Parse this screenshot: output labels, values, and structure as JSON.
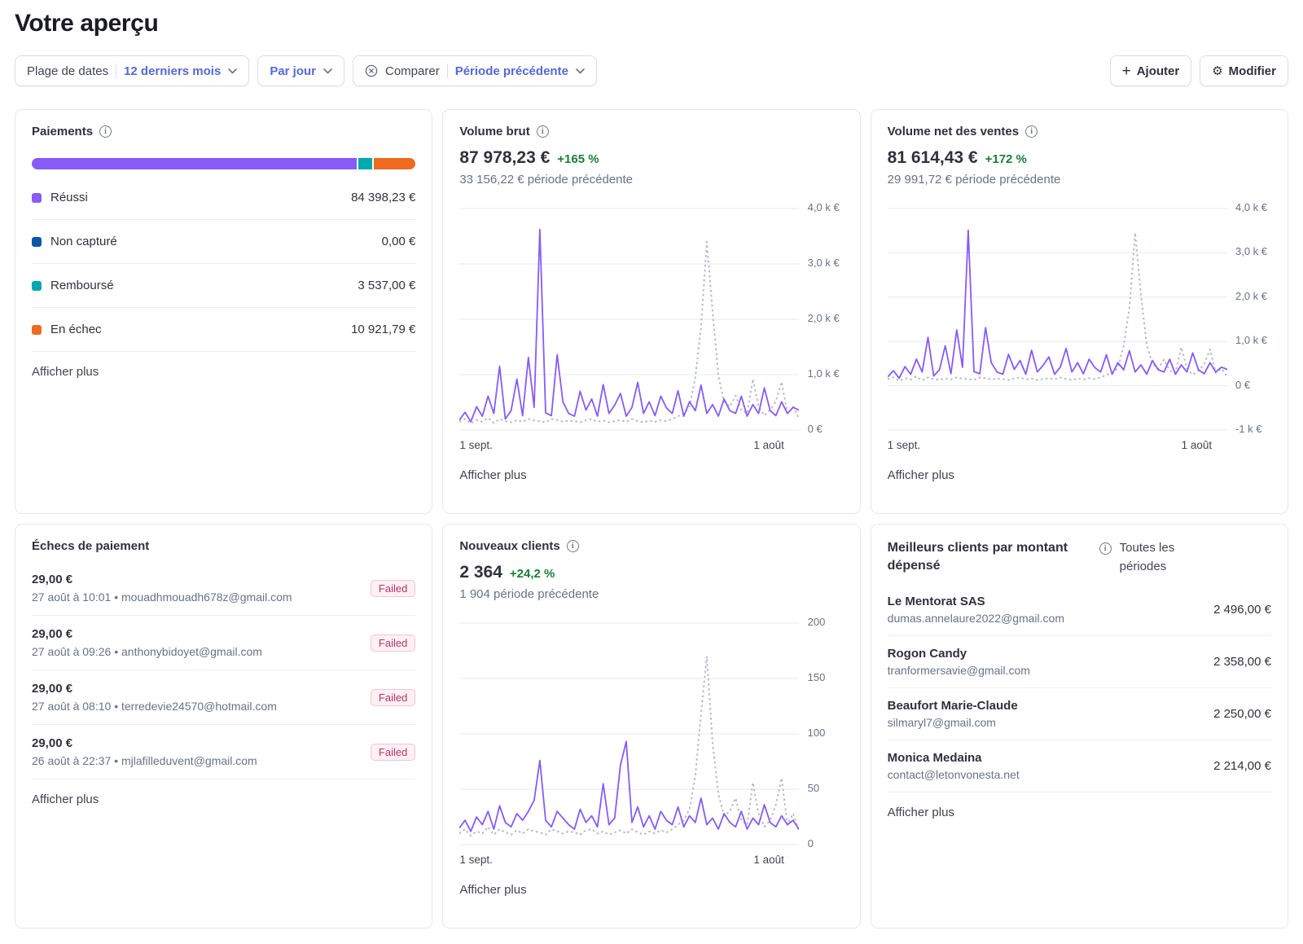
{
  "header": {
    "title": "Votre aperçu"
  },
  "icons": {
    "info": "i",
    "plus": "+",
    "gear": "⚙"
  },
  "colors": {
    "accent_purple": "#875bf7",
    "compare_gray": "#b3bbc8",
    "grid": "#e7eaf0",
    "success_green": "#1a7f37",
    "link_blue": "#5469d4",
    "navy": "#0e56a8",
    "teal": "#00a8b0",
    "orange": "#ed6a1f",
    "badge_bg": "#fff0f3",
    "badge_text": "#b3356b",
    "badge_border": "#f0c6d4"
  },
  "toolbar": {
    "filters": {
      "date_range_label": "Plage de dates",
      "date_range_value": "12 derniers mois",
      "interval_value": "Par jour",
      "compare_label": "Comparer",
      "compare_value": "Période précédente"
    },
    "actions": {
      "add": "Ajouter",
      "edit": "Modifier"
    }
  },
  "cards": {
    "payments": {
      "title": "Paiements",
      "items": [
        {
          "label": "Réussi",
          "value": "84 398,23 €",
          "color": "#875bf7",
          "fraction": 0.854
        },
        {
          "label": "Non capturé",
          "value": "0,00 €",
          "color": "#0e56a8",
          "fraction": 0
        },
        {
          "label": "Remboursé",
          "value": "3 537,00 €",
          "color": "#00a8b0",
          "fraction": 0.036
        },
        {
          "label": "En échec",
          "value": "10 921,79 €",
          "color": "#ed6a1f",
          "fraction": 0.11
        }
      ],
      "show_more": "Afficher plus"
    },
    "gross_volume": {
      "title": "Volume brut",
      "amount": "87 978,23 €",
      "delta": "+165 %",
      "previous": "33 156,22 € période précédente",
      "show_more": "Afficher plus"
    },
    "net_volume": {
      "title": "Volume net des ventes",
      "amount": "81 614,43 €",
      "delta": "+172 %",
      "previous": "29 991,72 € période précédente",
      "show_more": "Afficher plus"
    },
    "failed_payments": {
      "title": "Échecs de paiement",
      "items": [
        {
          "amount": "29,00 €",
          "meta": "27 août à 10:01 • mouadhmouadh678z@gmail.com",
          "badge": "Failed"
        },
        {
          "amount": "29,00 €",
          "meta": "27 août à 09:26 • anthonybidoyet@gmail.com",
          "badge": "Failed"
        },
        {
          "amount": "29,00 €",
          "meta": "27 août à 08:10 • terredevie24570@hotmail.com",
          "badge": "Failed"
        },
        {
          "amount": "29,00 €",
          "meta": "26 août à 22:37 • mjlafilleduvent@gmail.com",
          "badge": "Failed"
        }
      ],
      "show_more": "Afficher plus"
    },
    "new_customers": {
      "title": "Nouveaux clients",
      "amount": "2 364",
      "delta": "+24,2 %",
      "previous": "1 904 période précédente",
      "show_more": "Afficher plus"
    },
    "top_customers": {
      "title": "Meilleurs clients par montant dépensé",
      "period_label": "Toutes les périodes",
      "items": [
        {
          "name": "Le Mentorat SAS",
          "email": "dumas.annelaure2022@gmail.com",
          "amount": "2 496,00 €"
        },
        {
          "name": "Rogon Candy",
          "email": "tranformersavie@gmail.com",
          "amount": "2 358,00 €"
        },
        {
          "name": "Beaufort Marie-Claude",
          "email": "silmaryl7@gmail.com",
          "amount": "2 250,00 €"
        },
        {
          "name": "Monica Medaina",
          "email": "contact@letonvonesta.net",
          "amount": "2 214,00 €"
        }
      ],
      "show_more": "Afficher plus"
    }
  },
  "chart_data": [
    {
      "id": "gross_volume",
      "type": "line",
      "title": "Volume brut",
      "ylim": [
        0,
        4000
      ],
      "yticks": [
        {
          "value": 4000,
          "label": "4,0 k €"
        },
        {
          "value": 3000,
          "label": "3,0 k €"
        },
        {
          "value": 2000,
          "label": "2,0 k €"
        },
        {
          "value": 1000,
          "label": "1,0 k €"
        },
        {
          "value": 0,
          "label": "0 €"
        }
      ],
      "x_labels": [
        "1 sept.",
        "1 août"
      ],
      "series": [
        {
          "name": "current",
          "values": [
            180,
            320,
            150,
            420,
            250,
            610,
            300,
            1150,
            200,
            350,
            920,
            260,
            1310,
            410,
            3620,
            310,
            260,
            1360,
            510,
            300,
            250,
            700,
            360,
            560,
            250,
            820,
            300,
            450,
            660,
            250,
            410,
            860,
            300,
            510,
            260,
            610,
            400,
            300,
            710,
            250,
            510,
            350,
            810,
            300,
            460,
            250,
            560,
            350,
            300,
            610,
            250,
            460,
            300,
            760,
            350,
            260,
            510,
            300,
            410,
            360
          ]
        },
        {
          "name": "previous",
          "style": "dashed",
          "values": [
            150,
            200,
            120,
            180,
            150,
            220,
            130,
            200,
            160,
            140,
            180,
            150,
            200,
            170,
            160,
            140,
            200,
            180,
            150,
            170,
            160,
            140,
            180,
            200,
            150,
            170,
            140,
            160,
            180,
            150,
            200,
            160,
            140,
            170,
            150,
            180,
            160,
            200,
            250,
            300,
            420,
            950,
            1850,
            3400,
            2150,
            980,
            520,
            420,
            620,
            360,
            300,
            920,
            420,
            260,
            360,
            520,
            870,
            300,
            420,
            210
          ]
        }
      ]
    },
    {
      "id": "net_volume",
      "type": "line",
      "title": "Volume net des ventes",
      "ylim": [
        -1000,
        4000
      ],
      "yticks": [
        {
          "value": 4000,
          "label": "4,0 k €"
        },
        {
          "value": 3000,
          "label": "3,0 k €"
        },
        {
          "value": 2000,
          "label": "2,0 k €"
        },
        {
          "value": 1000,
          "label": "1,0 k €"
        },
        {
          "value": 0,
          "label": "0 €"
        },
        {
          "value": -1000,
          "label": "-1 k €"
        }
      ],
      "x_labels": [
        "1 sept.",
        "1 août"
      ],
      "series": [
        {
          "name": "current",
          "values": [
            200,
            340,
            170,
            430,
            260,
            600,
            310,
            1090,
            220,
            360,
            900,
            270,
            1260,
            420,
            3510,
            320,
            270,
            1310,
            520,
            310,
            260,
            710,
            370,
            570,
            260,
            800,
            310,
            460,
            650,
            260,
            420,
            840,
            310,
            520,
            270,
            600,
            410,
            310,
            700,
            260,
            520,
            360,
            790,
            310,
            470,
            260,
            570,
            360,
            310,
            600,
            260,
            470,
            310,
            740,
            360,
            270,
            520,
            310,
            420,
            370
          ]
        },
        {
          "name": "previous",
          "style": "dashed",
          "values": [
            140,
            190,
            110,
            170,
            140,
            210,
            120,
            190,
            150,
            130,
            170,
            140,
            190,
            160,
            150,
            130,
            190,
            170,
            140,
            160,
            150,
            130,
            170,
            190,
            140,
            160,
            130,
            150,
            170,
            140,
            190,
            150,
            130,
            160,
            140,
            170,
            150,
            190,
            240,
            290,
            400,
            900,
            1750,
            3450,
            2050,
            930,
            490,
            390,
            590,
            340,
            290,
            870,
            390,
            250,
            340,
            490,
            820,
            290,
            390,
            200
          ]
        }
      ]
    },
    {
      "id": "new_customers",
      "type": "line",
      "title": "Nouveaux clients",
      "ylim": [
        0,
        200
      ],
      "yticks": [
        {
          "value": 200,
          "label": "200"
        },
        {
          "value": 150,
          "label": "150"
        },
        {
          "value": 100,
          "label": "100"
        },
        {
          "value": 50,
          "label": "50"
        },
        {
          "value": 0,
          "label": "0"
        }
      ],
      "x_labels": [
        "1 sept.",
        "1 août"
      ],
      "series": [
        {
          "name": "current",
          "values": [
            15,
            22,
            12,
            25,
            18,
            30,
            14,
            35,
            20,
            16,
            28,
            22,
            30,
            40,
            76,
            22,
            16,
            30,
            24,
            18,
            14,
            32,
            20,
            26,
            16,
            55,
            18,
            24,
            72,
            93,
            20,
            34,
            16,
            26,
            14,
            30,
            22,
            18,
            34,
            16,
            26,
            20,
            42,
            18,
            24,
            14,
            28,
            20,
            16,
            30,
            14,
            24,
            18,
            36,
            20,
            16,
            26,
            18,
            22,
            14
          ]
        },
        {
          "name": "previous",
          "style": "dashed",
          "values": [
            10,
            14,
            8,
            12,
            10,
            16,
            9,
            14,
            11,
            9,
            13,
            10,
            14,
            12,
            11,
            9,
            14,
            12,
            10,
            12,
            11,
            9,
            13,
            14,
            10,
            12,
            9,
            11,
            13,
            10,
            14,
            11,
            9,
            12,
            10,
            13,
            11,
            14,
            18,
            22,
            32,
            62,
            118,
            170,
            92,
            46,
            26,
            30,
            42,
            22,
            18,
            56,
            28,
            16,
            22,
            36,
            60,
            18,
            28,
            12
          ]
        }
      ]
    }
  ]
}
